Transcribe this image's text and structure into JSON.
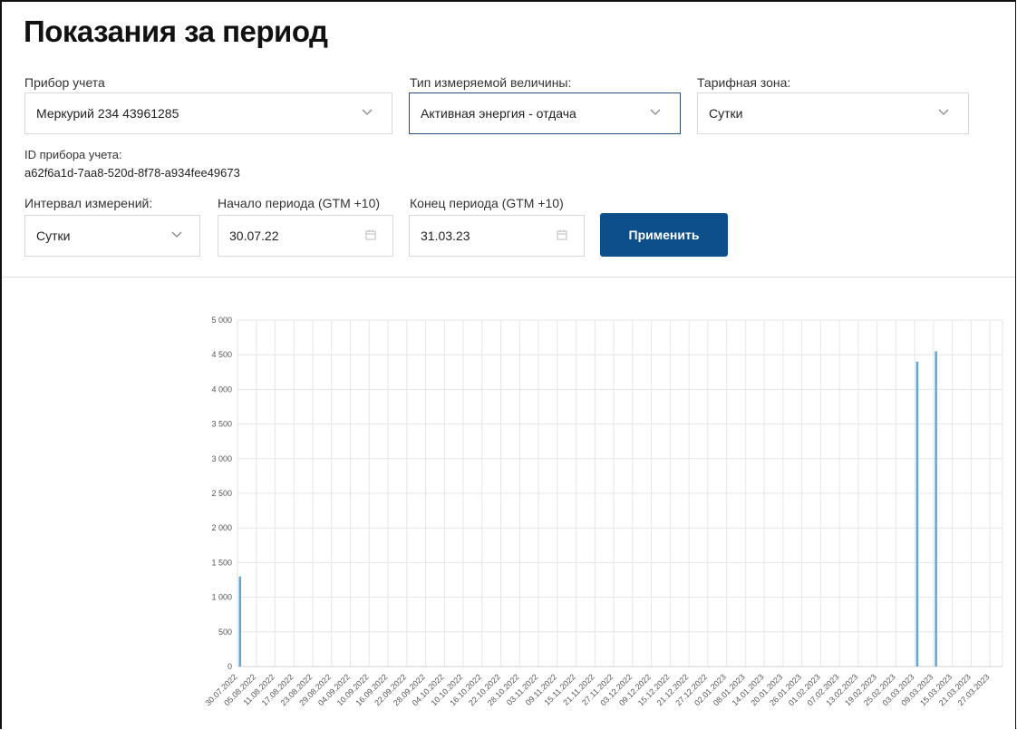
{
  "page": {
    "title": "Показания за период"
  },
  "filters": {
    "meter": {
      "label": "Прибор учета",
      "value": "Меркурий 234 43961285"
    },
    "measure_type": {
      "label": "Тип измеряемой величины:",
      "value": "Активная энергия - отдача"
    },
    "tariff_zone": {
      "label": "Тарифная зона:",
      "value": "Сутки"
    },
    "meter_id": {
      "label": "ID прибора учета:",
      "value": "a62f6a1d-7aa8-520d-8f78-a934fee49673"
    },
    "interval": {
      "label": "Интервал измерений:",
      "value": "Сутки"
    },
    "start": {
      "label": "Начало периода (GTM +10)",
      "value": "30.07.22"
    },
    "end": {
      "label": "Конец периода (GTM +10)",
      "value": "31.03.23"
    },
    "apply_label": "Применить"
  },
  "icons": {
    "dropdown": "chevron-down-icon",
    "date": "calendar-icon"
  },
  "colors": {
    "accent": "#0d4f8b",
    "bar": "#5aa7e0"
  },
  "chart_data": {
    "type": "bar",
    "ylim": [
      0,
      5000
    ],
    "yticks": [
      0,
      500,
      1000,
      1500,
      2000,
      2500,
      3000,
      3500,
      4000,
      4500,
      5000
    ],
    "ytick_labels": [
      "0",
      "500",
      "1 000",
      "1 500",
      "2 000",
      "2 500",
      "3 000",
      "3 500",
      "4 000",
      "4 500",
      "5 000"
    ],
    "x_start": "30.07.2022",
    "x_end": "31.03.2023",
    "xtick_labels": [
      "30.07.2022",
      "05.08.2022",
      "11.08.2022",
      "17.08.2022",
      "23.08.2022",
      "29.08.2022",
      "04.09.2022",
      "10.09.2022",
      "16.09.2022",
      "22.09.2022",
      "28.09.2022",
      "04.10.2022",
      "10.10.2022",
      "16.10.2022",
      "22.10.2022",
      "28.10.2022",
      "03.11.2022",
      "09.11.2022",
      "15.11.2022",
      "21.11.2022",
      "27.11.2022",
      "03.12.2022",
      "09.12.2022",
      "15.12.2022",
      "21.12.2022",
      "27.12.2022",
      "02.01.2023",
      "08.01.2023",
      "14.01.2023",
      "20.01.2023",
      "26.01.2023",
      "01.02.2023",
      "07.02.2023",
      "13.02.2023",
      "19.02.2023",
      "25.02.2023",
      "03.03.2023",
      "09.03.2023",
      "15.03.2023",
      "21.03.2023",
      "27.03.2023"
    ],
    "points": [
      {
        "x": "30.07.2022",
        "y": 1300
      },
      {
        "x": "03.03.2023",
        "y": 4400
      },
      {
        "x": "09.03.2023",
        "y": 4550
      }
    ],
    "grid": true,
    "legend": false
  }
}
